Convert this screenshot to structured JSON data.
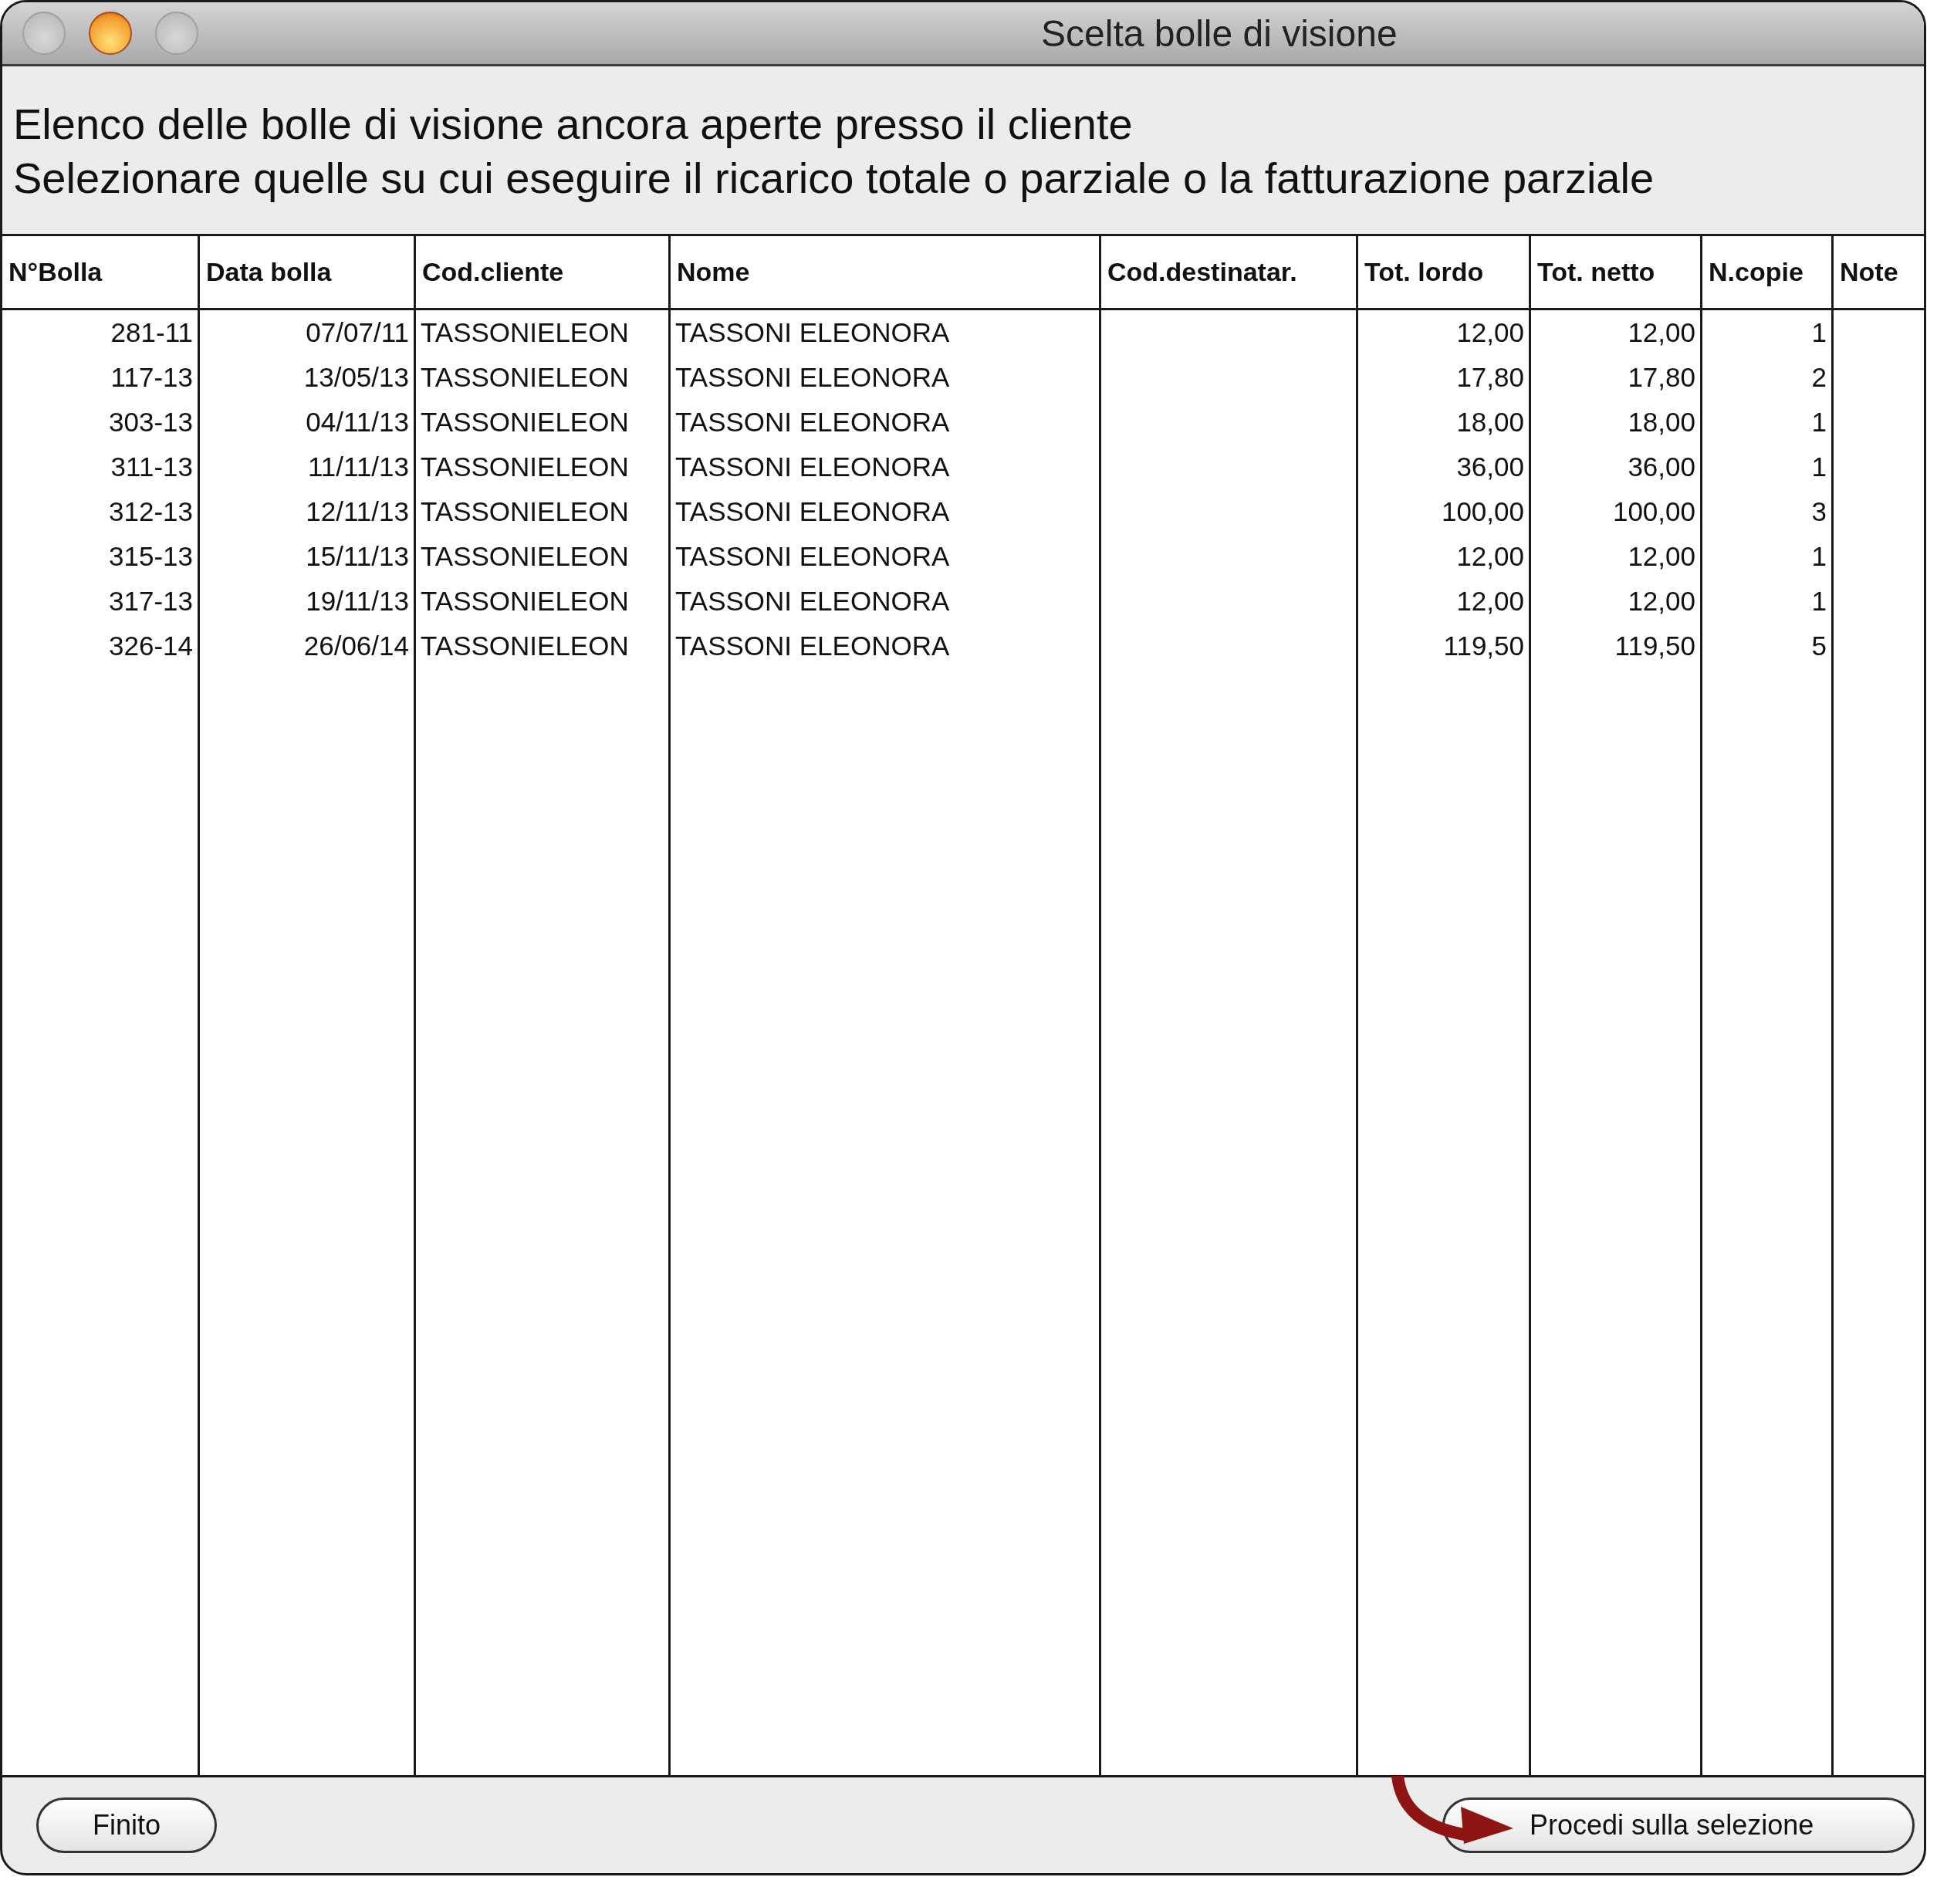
{
  "window": {
    "title": "Scelta bolle di visione"
  },
  "description": [
    "Elenco delle bolle di visione ancora aperte presso il cliente",
    "Selezionare quelle su cui eseguire il ricarico totale o parziale o la fatturazione parziale"
  ],
  "table": {
    "columns": [
      "N°Bolla",
      "Data bolla",
      "Cod.cliente",
      "Nome",
      "Cod.destinatar.",
      "Tot. lordo",
      "Tot. netto",
      "N.copie",
      "Note"
    ],
    "rows": [
      [
        "281-11",
        "07/07/11",
        "TASSONIELEON",
        "TASSONI ELEONORA",
        "",
        "12,00",
        "12,00",
        "1",
        ""
      ],
      [
        "117-13",
        "13/05/13",
        "TASSONIELEON",
        "TASSONI ELEONORA",
        "",
        "17,80",
        "17,80",
        "2",
        ""
      ],
      [
        "303-13",
        "04/11/13",
        "TASSONIELEON",
        "TASSONI ELEONORA",
        "",
        "18,00",
        "18,00",
        "1",
        ""
      ],
      [
        "311-13",
        "11/11/13",
        "TASSONIELEON",
        "TASSONI ELEONORA",
        "",
        "36,00",
        "36,00",
        "1",
        ""
      ],
      [
        "312-13",
        "12/11/13",
        "TASSONIELEON",
        "TASSONI ELEONORA",
        "",
        "100,00",
        "100,00",
        "3",
        ""
      ],
      [
        "315-13",
        "15/11/13",
        "TASSONIELEON",
        "TASSONI ELEONORA",
        "",
        "12,00",
        "12,00",
        "1",
        ""
      ],
      [
        "317-13",
        "19/11/13",
        "TASSONIELEON",
        "TASSONI ELEONORA",
        "",
        "12,00",
        "12,00",
        "1",
        ""
      ],
      [
        "326-14",
        "26/06/14",
        "TASSONIELEON",
        "TASSONI ELEONORA",
        "",
        "119,50",
        "119,50",
        "5",
        ""
      ]
    ]
  },
  "buttons": {
    "left": "Finito",
    "right": "Procedi sulla selezione"
  }
}
